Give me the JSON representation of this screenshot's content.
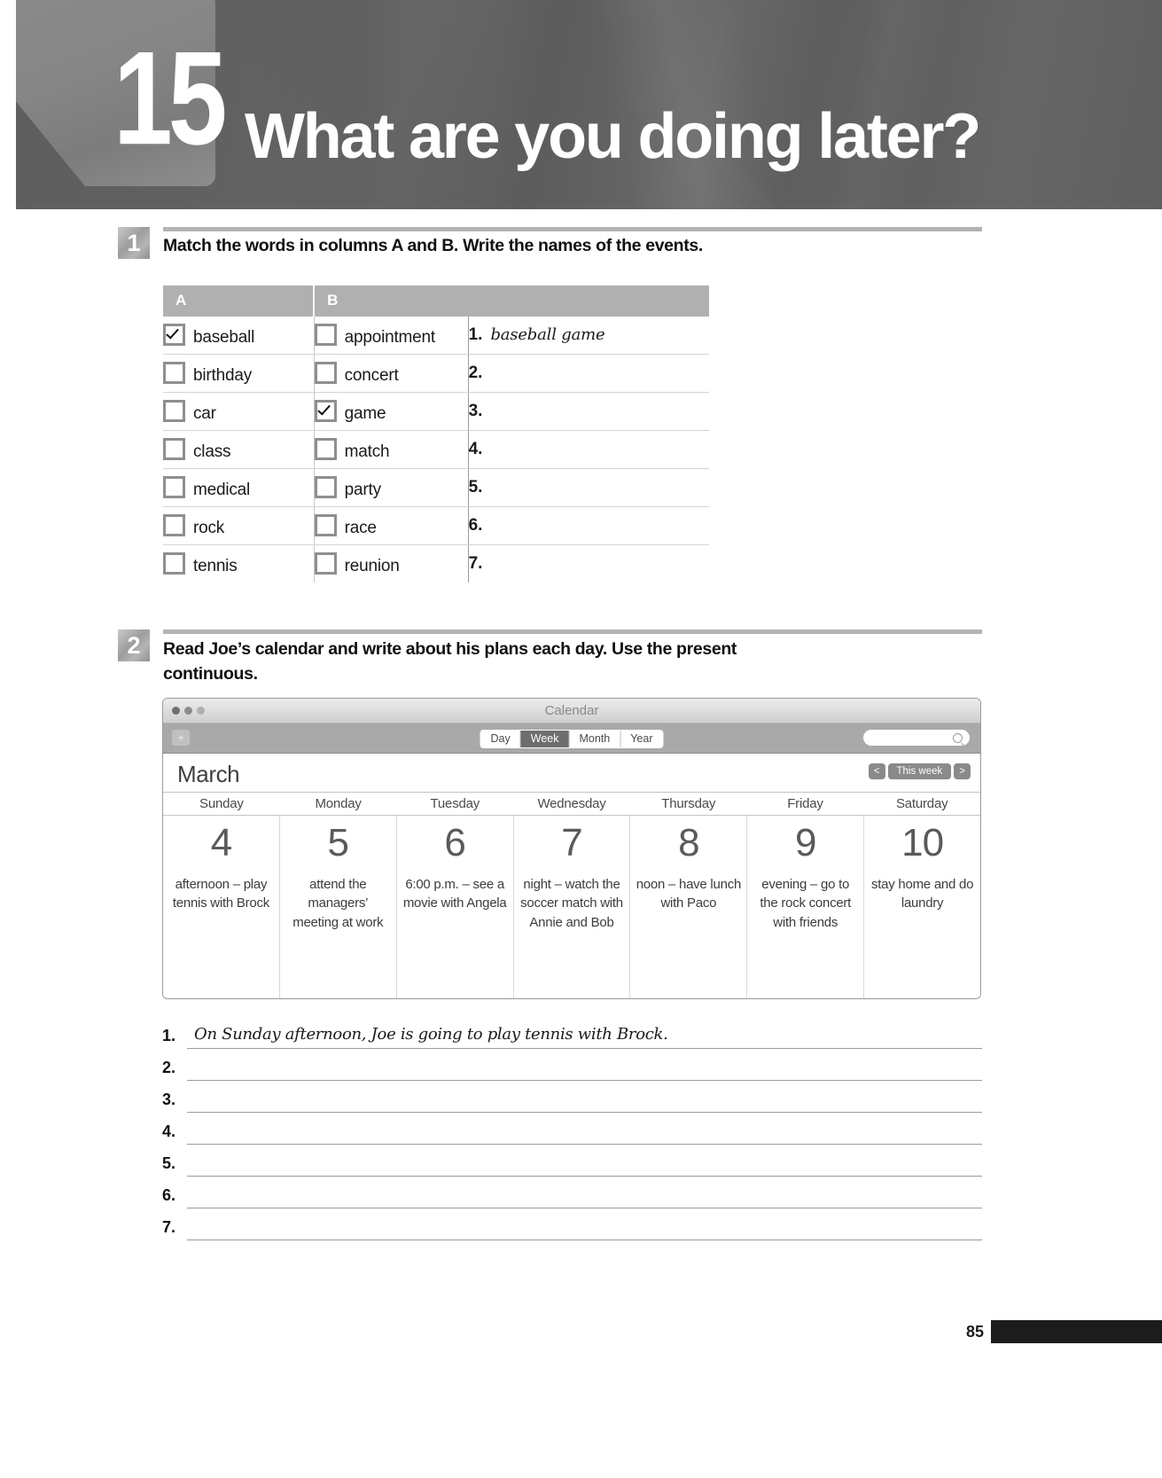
{
  "header": {
    "chapter_number": "15",
    "chapter_title": "What are you doing later?"
  },
  "exercise1": {
    "number": "1",
    "instruction": "Match the words in columns A and B. Write the names of the events.",
    "table": {
      "headers": {
        "col_a": "A",
        "col_b": "B",
        "col_answers": ""
      },
      "column_a": [
        {
          "word": "baseball",
          "checked": true
        },
        {
          "word": "birthday",
          "checked": false
        },
        {
          "word": "car",
          "checked": false
        },
        {
          "word": "class",
          "checked": false
        },
        {
          "word": "medical",
          "checked": false
        },
        {
          "word": "rock",
          "checked": false
        },
        {
          "word": "tennis",
          "checked": false
        }
      ],
      "column_b": [
        {
          "word": "appointment",
          "checked": false
        },
        {
          "word": "concert",
          "checked": false
        },
        {
          "word": "game",
          "checked": true
        },
        {
          "word": "match",
          "checked": false
        },
        {
          "word": "party",
          "checked": false
        },
        {
          "word": "race",
          "checked": false
        },
        {
          "word": "reunion",
          "checked": false
        }
      ],
      "answers": [
        {
          "num": "1.",
          "text": "baseball game"
        },
        {
          "num": "2.",
          "text": ""
        },
        {
          "num": "3.",
          "text": ""
        },
        {
          "num": "4.",
          "text": ""
        },
        {
          "num": "5.",
          "text": ""
        },
        {
          "num": "6.",
          "text": ""
        },
        {
          "num": "7.",
          "text": ""
        }
      ]
    }
  },
  "exercise2": {
    "number": "2",
    "instruction": "Read Joe’s calendar and write about his plans each day. Use the present continuous.",
    "calendar": {
      "window_title": "Calendar",
      "add_button": "+",
      "view_options": [
        {
          "label": "Day",
          "active": false
        },
        {
          "label": "Week",
          "active": true
        },
        {
          "label": "Month",
          "active": false
        },
        {
          "label": "Year",
          "active": false
        }
      ],
      "search_placeholder": "",
      "month": "March",
      "nav": {
        "prev": "<",
        "today": "This week",
        "next": ">"
      },
      "day_names": [
        "Sunday",
        "Monday",
        "Tuesday",
        "Wednesday",
        "Thursday",
        "Friday",
        "Saturday"
      ],
      "days": [
        {
          "date": "4",
          "event": "afternoon – play tennis with Brock"
        },
        {
          "date": "5",
          "event": "attend the managers’ meeting at work"
        },
        {
          "date": "6",
          "event": "6:00 p.m. – see a movie with Angela"
        },
        {
          "date": "7",
          "event": "night – watch the soccer match with Annie and Bob"
        },
        {
          "date": "8",
          "event": "noon – have lunch with Paco"
        },
        {
          "date": "9",
          "event": "evening – go to the rock concert with friends"
        },
        {
          "date": "10",
          "event": "stay home and do laundry"
        }
      ]
    },
    "answers": [
      {
        "num": "1.",
        "text": "On Sunday afternoon, Joe is going to play tennis with Brock."
      },
      {
        "num": "2.",
        "text": ""
      },
      {
        "num": "3.",
        "text": ""
      },
      {
        "num": "4.",
        "text": ""
      },
      {
        "num": "5.",
        "text": ""
      },
      {
        "num": "6.",
        "text": ""
      },
      {
        "num": "7.",
        "text": ""
      }
    ]
  },
  "footer": {
    "page_number": "85"
  }
}
